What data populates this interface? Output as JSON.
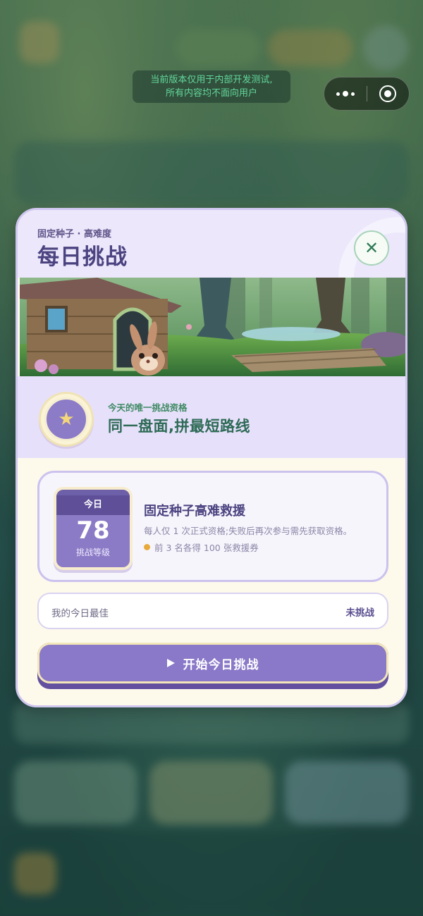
{
  "dev_notice": {
    "line1": "当前版本仅用于内部开发测试,",
    "line2": "所有内容均不面向用户"
  },
  "capsule": {
    "menu_icon": "more-dots-icon",
    "close_icon": "target-circle-icon"
  },
  "modal": {
    "subtitle": "固定种子 · 高难度",
    "title": "每日挑战",
    "close_icon": "close-x-icon",
    "band": {
      "icon": "star-icon",
      "subtitle": "今天的唯一挑战资格",
      "title": "同一盘面,拼最短路线"
    },
    "card": {
      "calendar": {
        "header": "今日",
        "level": "78",
        "level_label": "挑战等级"
      },
      "title": "固定种子高难救援",
      "description": "每人仅 1 次正式资格;失败后再次参与需先获取资格。",
      "reward": "前 3 名各得 100 张救援券"
    },
    "best": {
      "label": "我的今日最佳",
      "value": "未挑战"
    },
    "start_button": {
      "icon": "play-icon",
      "label": "开始今日挑战"
    }
  },
  "colors": {
    "accent_purple": "#8a78c8",
    "title_purple": "#4b4380",
    "green_text": "#2d6a55",
    "dev_notice_green": "#62d79a",
    "reward_dot": "#e7a93c"
  }
}
